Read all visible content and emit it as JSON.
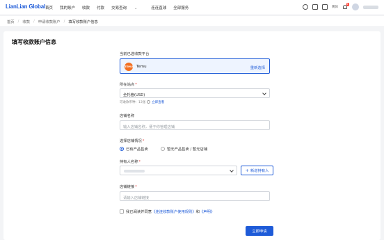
{
  "app": {
    "logo": "LianLian Global",
    "nav": [
      {
        "label": "首页"
      },
      {
        "label": "我的账户"
      },
      {
        "label": "收款"
      },
      {
        "label": "付款"
      },
      {
        "label": "交易查询"
      },
      {
        "label": "连连直球"
      },
      {
        "label": "全部服务"
      }
    ],
    "lang": "简体",
    "notification_count": "1"
  },
  "breadcrumb": [
    "首页",
    "收款",
    "申请收款账户",
    "填写收款账户信息"
  ],
  "page": {
    "title": "填写收款账户信息"
  },
  "form": {
    "platform_label": "当前已选收款平台",
    "platform_logo_text": "TEMU",
    "platform_name": "Temu",
    "reselect_label": "重新选择",
    "site_label": "所在站点",
    "site_value": "全托管(USD)",
    "site_hint": "可收款币种：13张",
    "site_hint_link": "立即查看",
    "store_name_label": "店铺名称",
    "store_name_placeholder": "输入店铺名称，便于你管理店铺",
    "store_status_label": "选择店铺情况",
    "store_status_options": [
      {
        "label": "已有产品售卖",
        "selected": true
      },
      {
        "label": "暂无产品售卖 / 暂无店铺",
        "selected": false
      }
    ],
    "owner_label": "持有人名称",
    "add_owner_label": "新增持有人",
    "store_link_label": "店铺链接",
    "store_link_placeholder": "请输入店铺链接",
    "agree_prefix": "我已阅读并同意",
    "agree_link1": "《连连收款账户使用规则》",
    "agree_and": "和",
    "agree_link2": "《声明》",
    "submit_label": "立即申请"
  },
  "colors": {
    "primary": "#1e5bd8",
    "temu": "#f36f21",
    "required": "#e53935"
  }
}
